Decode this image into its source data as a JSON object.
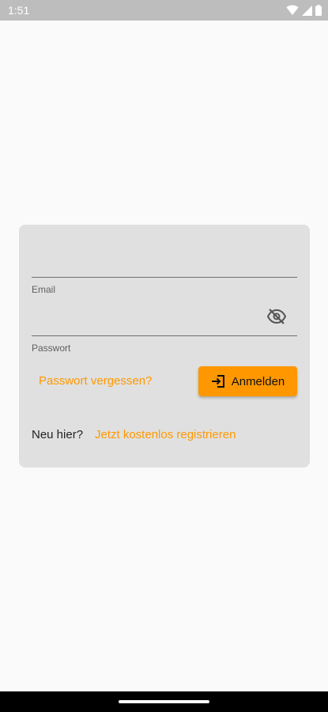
{
  "status_bar": {
    "time": "1:51",
    "icons": [
      "wifi-icon",
      "signal-icon",
      "battery-icon"
    ]
  },
  "login_card": {
    "email": {
      "label": "Email",
      "value": ""
    },
    "password": {
      "label": "Passwort",
      "value": "",
      "toggle_icon": "visibility-off-icon"
    },
    "forgot_password_label": "Passwort vergessen?",
    "login_button": {
      "icon": "login-icon",
      "label": "Anmelden"
    },
    "new_here_label": "Neu hier?",
    "register_label": "Jetzt kostenlos registrieren"
  },
  "colors": {
    "accent": "#ff9800",
    "card_background": "#e0e0e0",
    "page_background": "#fafafa",
    "status_bar": "#bdbdbd"
  }
}
